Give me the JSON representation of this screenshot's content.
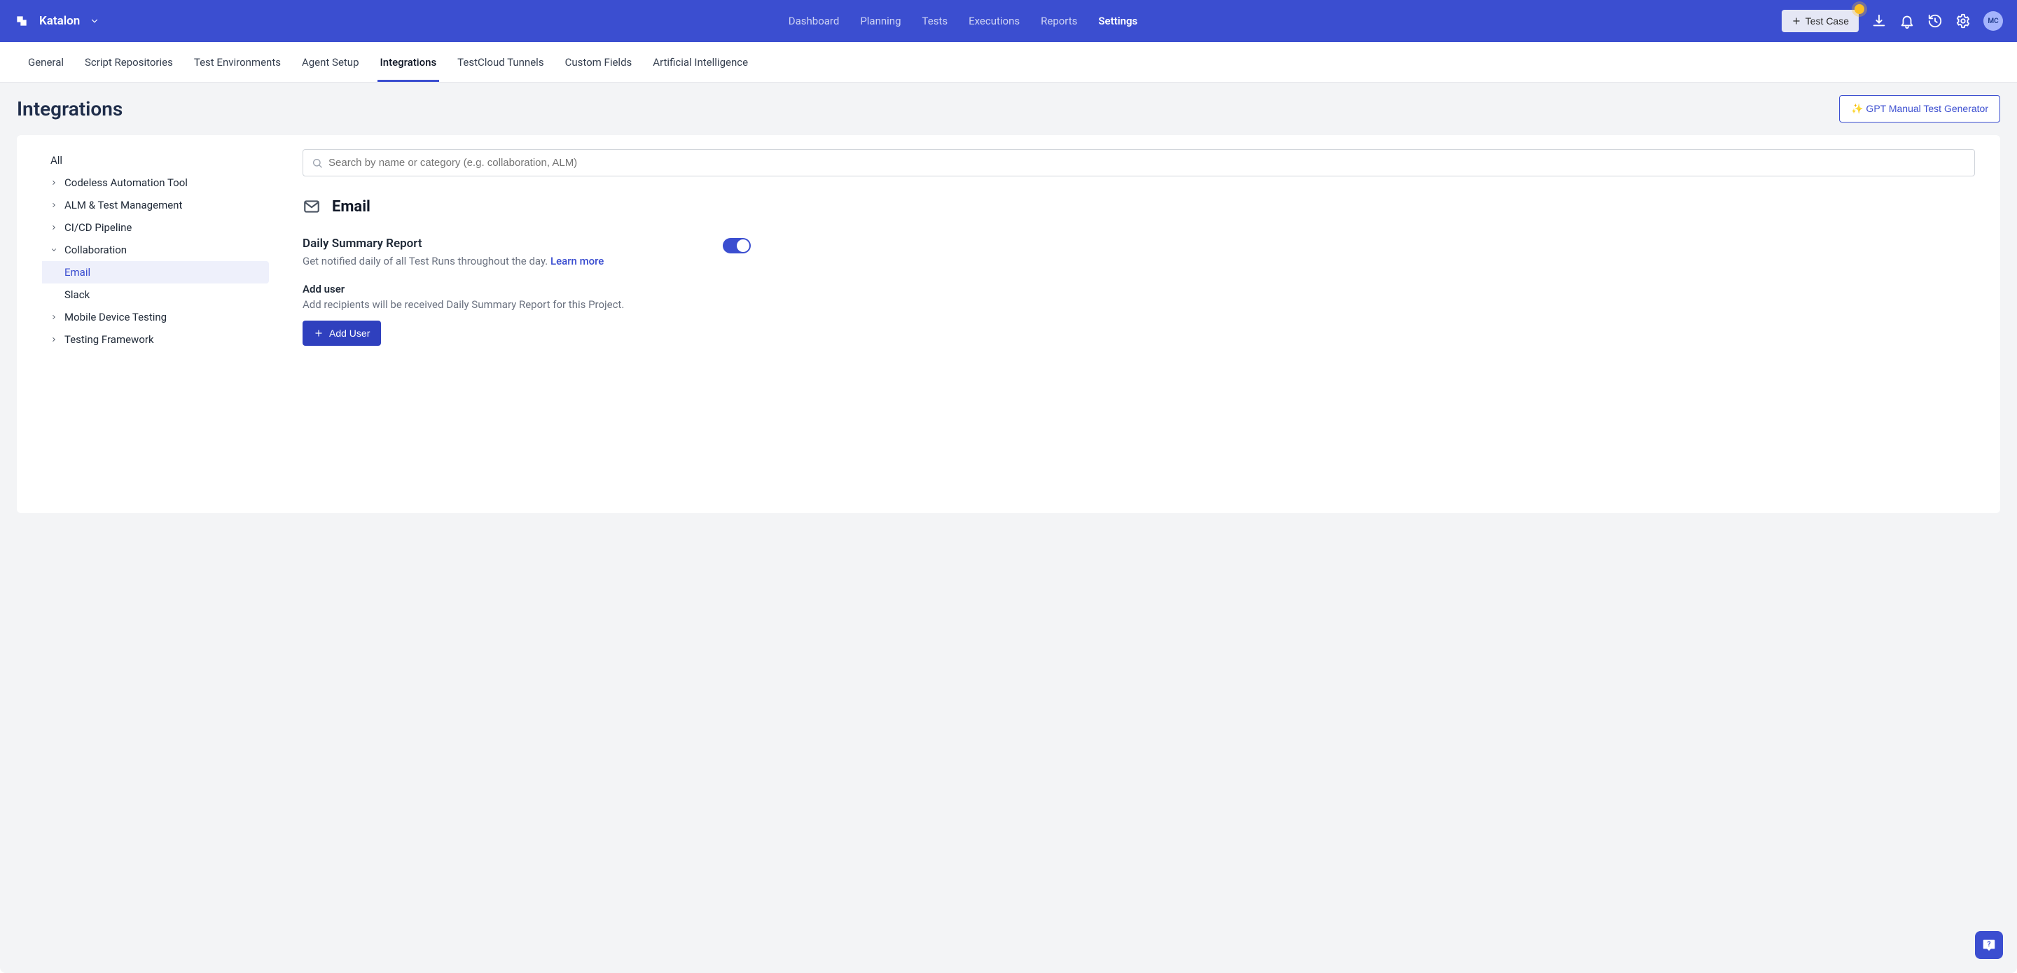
{
  "header": {
    "brand": "Katalon",
    "nav": [
      "Dashboard",
      "Planning",
      "Tests",
      "Executions",
      "Reports",
      "Settings"
    ],
    "nav_active_index": 5,
    "test_case_btn": "Test Case",
    "avatar_initials": "MC"
  },
  "subtabs": {
    "items": [
      "General",
      "Script Repositories",
      "Test Environments",
      "Agent Setup",
      "Integrations",
      "TestCloud Tunnels",
      "Custom Fields",
      "Artificial Intelligence"
    ],
    "active_index": 4
  },
  "page": {
    "title": "Integrations",
    "gpt_button": "✨ GPT Manual Test Generator"
  },
  "sidebar": {
    "all_label": "All",
    "categories": [
      {
        "label": "Codeless Automation Tool",
        "expanded": false
      },
      {
        "label": "ALM & Test Management",
        "expanded": false
      },
      {
        "label": "CI/CD Pipeline",
        "expanded": false
      },
      {
        "label": "Collaboration",
        "expanded": true,
        "children": [
          "Email",
          "Slack"
        ],
        "selected_child_index": 0
      },
      {
        "label": "Mobile Device Testing",
        "expanded": false
      },
      {
        "label": "Testing Framework",
        "expanded": false
      }
    ]
  },
  "main": {
    "search_placeholder": "Search by name or category (e.g. collaboration, ALM)",
    "section_title": "Email",
    "daily_summary": {
      "title": "Daily Summary Report",
      "description": "Get notified daily of all Test Runs throughout the day. ",
      "learn_more_label": "Learn more",
      "enabled": true
    },
    "add_user": {
      "title": "Add user",
      "description": "Add recipients will be received Daily Summary Report for this Project.",
      "button": "Add User"
    }
  }
}
